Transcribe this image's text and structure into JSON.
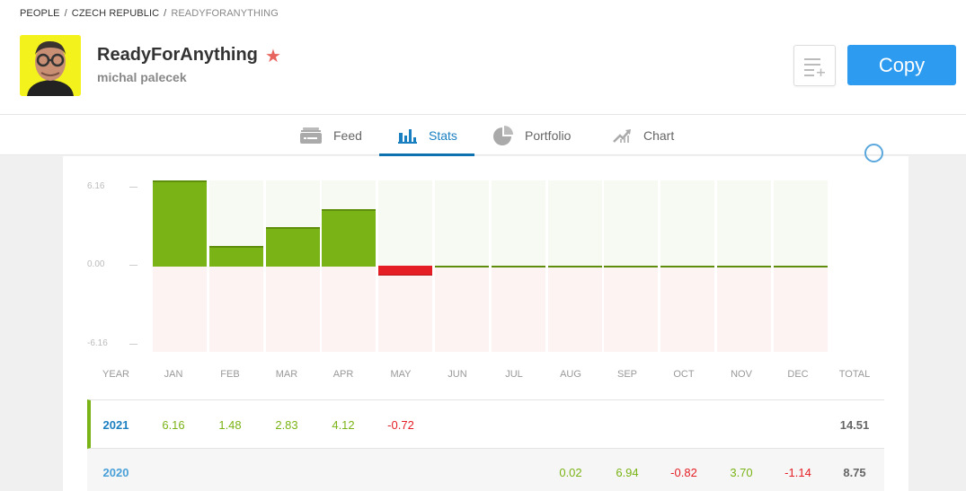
{
  "breadcrumb": [
    "PEOPLE",
    "CZECH REPUBLIC",
    "READYFORANYTHING"
  ],
  "profile": {
    "username": "ReadyForAnything",
    "full_name": "michal palecek",
    "avatar_bg": "#f4f21c",
    "star_color": "#e8645e"
  },
  "actions": {
    "watch_icon": "list-add-icon",
    "copy_label": "Copy",
    "copy_color": "#2d9bf0"
  },
  "tabs": [
    {
      "label": "Feed",
      "icon": "feed-icon",
      "active": false
    },
    {
      "label": "Stats",
      "icon": "bar-chart-icon",
      "active": true
    },
    {
      "label": "Portfolio",
      "icon": "pie-chart-icon",
      "active": false
    },
    {
      "label": "Chart",
      "icon": "line-chart-icon",
      "active": false
    }
  ],
  "chart_data": {
    "type": "bar",
    "title": "",
    "categories": [
      "JAN",
      "FEB",
      "MAR",
      "APR",
      "MAY",
      "JUN",
      "JUL",
      "AUG",
      "SEP",
      "OCT",
      "NOV",
      "DEC"
    ],
    "values": [
      6.16,
      1.48,
      2.83,
      4.12,
      -0.72,
      0,
      0,
      0,
      0,
      0,
      0,
      0
    ],
    "ylim": [
      -6.16,
      6.16
    ],
    "yticks": [
      "6.16",
      "0.00",
      "-6.16"
    ],
    "colors": {
      "positive": "#7ab315",
      "negative": "#e51e25",
      "pos_bg": "#f7faf2",
      "neg_bg": "#fcf3f2"
    },
    "xlabel": "",
    "ylabel": "",
    "grid": false
  },
  "table": {
    "headers": [
      "YEAR",
      "JAN",
      "FEB",
      "MAR",
      "APR",
      "MAY",
      "JUN",
      "JUL",
      "AUG",
      "SEP",
      "OCT",
      "NOV",
      "DEC",
      "TOTAL"
    ],
    "rows": [
      {
        "year": "2021",
        "values": [
          "6.16",
          "1.48",
          "2.83",
          "4.12",
          "-0.72",
          "",
          "",
          "",
          "",
          "",
          "",
          ""
        ],
        "total": "14.51"
      },
      {
        "year": "2020",
        "values": [
          "",
          "",
          "",
          "",
          "",
          "",
          "",
          "0.02",
          "6.94",
          "-0.82",
          "3.70",
          "-1.14"
        ],
        "total": "8.75"
      }
    ]
  }
}
